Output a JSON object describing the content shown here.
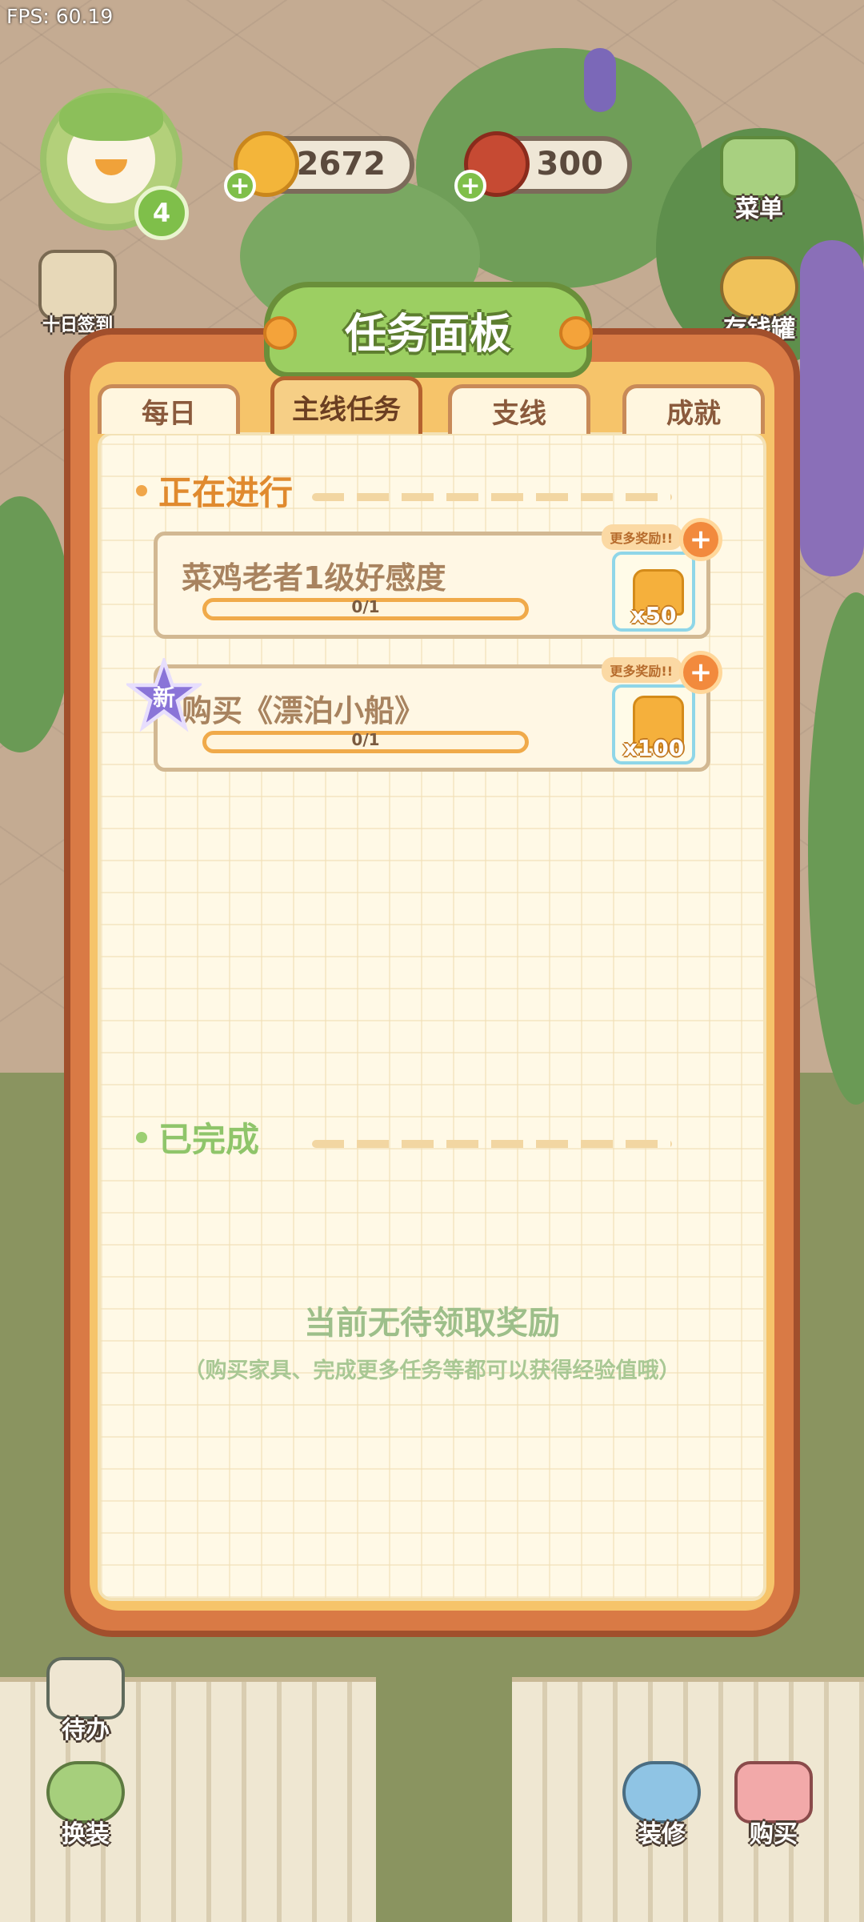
{
  "hud": {
    "fps": "FPS: 60.19",
    "level": "4",
    "coins": "2672",
    "food": "300"
  },
  "side_buttons": {
    "menu": "菜单",
    "checkin": "十日签到",
    "savings_jar": "存钱罐",
    "todo": "待办",
    "dress_up": "换装",
    "decorate": "装修",
    "buy": "购买"
  },
  "panel": {
    "title": "任务面板",
    "tabs": [
      {
        "label": "每日",
        "active": false
      },
      {
        "label": "主线任务",
        "active": true
      },
      {
        "label": "支线",
        "active": false
      },
      {
        "label": "成就",
        "active": false
      }
    ],
    "in_progress_label": "正在进行",
    "completed_label": "已完成",
    "tasks": [
      {
        "title": "菜鸡老者1级好感度",
        "progress_text": "0/1",
        "progress": 0,
        "more_rewards": "更多奖励!!",
        "reward_count": "x50",
        "is_new": false
      },
      {
        "title": "购买《漂泊小船》",
        "progress_text": "0/1",
        "progress": 0,
        "more_rewards": "更多奖励!!",
        "reward_count": "x100",
        "is_new": true,
        "new_label": "新"
      }
    ],
    "empty_message": "当前无待领取奖励",
    "empty_hint": "（购买家具、完成更多任务等都可以获得经验值哦）"
  },
  "colors": {
    "panel_border": "#a14f2c",
    "title_green": "#9ccf62",
    "progress_orange": "#f0aa4a",
    "in_progress_text": "#e08a2e",
    "completed_text": "#8fc56a"
  },
  "icons": {
    "coin": "coin-icon",
    "food": "meat-icon",
    "gift": "gift-icon",
    "new_star": "star-icon"
  }
}
